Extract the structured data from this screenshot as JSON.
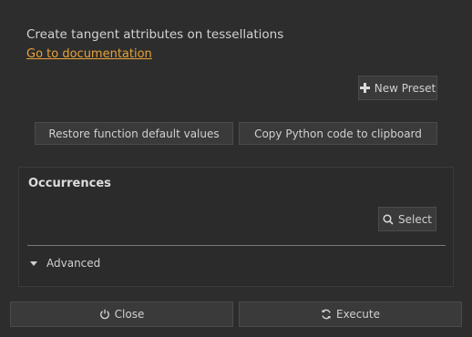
{
  "description": "Create tangent attributes on tessellations",
  "documentation_link": "Go to documentation",
  "presets": {
    "new_preset_label": "New Preset"
  },
  "actions": {
    "restore_label": "Restore function default values",
    "copy_label": "Copy Python code to clipboard"
  },
  "occurrences": {
    "title": "Occurrences",
    "select_label": "Select"
  },
  "advanced": {
    "label": "Advanced"
  },
  "footer": {
    "close_label": "Close",
    "execute_label": "Execute"
  },
  "colors": {
    "link": "#e8a33a",
    "background": "#2d2d2d",
    "button": "#3a3a3a"
  }
}
